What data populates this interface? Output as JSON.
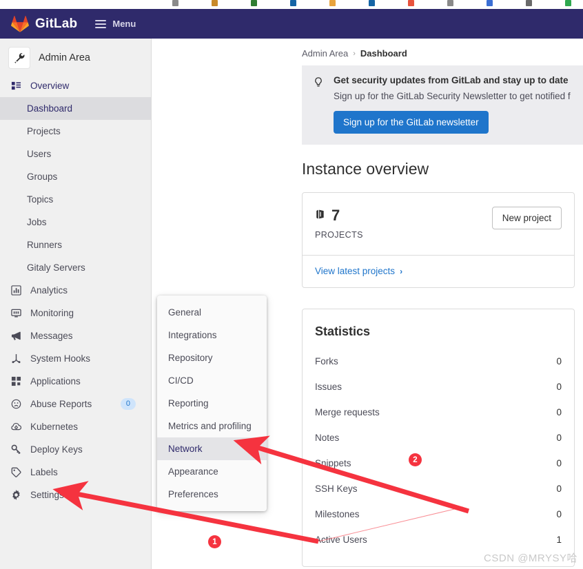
{
  "browser": {
    "bookmark_colors": [
      "#8a8a8a",
      "#c98a2a",
      "#2f7d32",
      "#1565a6",
      "#e8a33d",
      "#1565a6",
      "#e8533d",
      "#8a8a8a",
      "#3b6fd4",
      "#6a6a6a",
      "#2fa84f"
    ]
  },
  "navbar": {
    "brand": "GitLab",
    "menu_label": "Menu",
    "bg_color": "#2f2a6b"
  },
  "sidebar": {
    "context_name": "Admin Area",
    "context_icon": "wrench-icon",
    "items": [
      {
        "label": "Overview",
        "icon": "overview-icon",
        "type": "section",
        "active": false
      },
      {
        "label": "Dashboard",
        "icon": "",
        "type": "sub",
        "active": true
      },
      {
        "label": "Projects",
        "icon": "",
        "type": "sub",
        "active": false
      },
      {
        "label": "Users",
        "icon": "",
        "type": "sub",
        "active": false
      },
      {
        "label": "Groups",
        "icon": "",
        "type": "sub",
        "active": false
      },
      {
        "label": "Topics",
        "icon": "",
        "type": "sub",
        "active": false
      },
      {
        "label": "Jobs",
        "icon": "",
        "type": "sub",
        "active": false
      },
      {
        "label": "Runners",
        "icon": "",
        "type": "sub",
        "active": false
      },
      {
        "label": "Gitaly Servers",
        "icon": "",
        "type": "sub",
        "active": false
      },
      {
        "label": "Analytics",
        "icon": "chart-icon",
        "type": "item",
        "active": false
      },
      {
        "label": "Monitoring",
        "icon": "monitor-icon",
        "type": "item",
        "active": false
      },
      {
        "label": "Messages",
        "icon": "megaphone-icon",
        "type": "item",
        "active": false
      },
      {
        "label": "System Hooks",
        "icon": "hook-icon",
        "type": "item",
        "active": false
      },
      {
        "label": "Applications",
        "icon": "applications-icon",
        "type": "item",
        "active": false
      },
      {
        "label": "Abuse Reports",
        "icon": "abuse-icon",
        "type": "item",
        "active": false,
        "badge": "0"
      },
      {
        "label": "Kubernetes",
        "icon": "kubernetes-icon",
        "type": "item",
        "active": false
      },
      {
        "label": "Deploy Keys",
        "icon": "key-icon",
        "type": "item",
        "active": false
      },
      {
        "label": "Labels",
        "icon": "label-icon",
        "type": "item",
        "active": false
      },
      {
        "label": "Settings",
        "icon": "gear-icon",
        "type": "item",
        "active": false
      }
    ]
  },
  "flyout": {
    "items": [
      {
        "label": "General",
        "active": false
      },
      {
        "label": "Integrations",
        "active": false
      },
      {
        "label": "Repository",
        "active": false
      },
      {
        "label": "CI/CD",
        "active": false
      },
      {
        "label": "Reporting",
        "active": false
      },
      {
        "label": "Metrics and profiling",
        "active": false
      },
      {
        "label": "Network",
        "active": true
      },
      {
        "label": "Appearance",
        "active": false
      },
      {
        "label": "Preferences",
        "active": false
      }
    ]
  },
  "breadcrumb": {
    "root": "Admin Area",
    "separator": "›",
    "current": "Dashboard"
  },
  "banner": {
    "icon": "lightbulb-icon",
    "title": "Get security updates from GitLab and stay up to date",
    "description": "Sign up for the GitLab Security Newsletter to get notified f",
    "button_label": "Sign up for the GitLab newsletter",
    "button_color": "#1f75cb"
  },
  "main": {
    "page_title": "Instance overview",
    "projects_card": {
      "icon": "project-icon",
      "count": "7",
      "caption": "PROJECTS",
      "action_label": "New project",
      "link_label": "View latest projects",
      "link_chevron": "›"
    },
    "statistics": {
      "heading": "Statistics",
      "rows": [
        {
          "label": "Forks",
          "value": "0"
        },
        {
          "label": "Issues",
          "value": "0"
        },
        {
          "label": "Merge requests",
          "value": "0"
        },
        {
          "label": "Notes",
          "value": "0"
        },
        {
          "label": "Snippets",
          "value": "0"
        },
        {
          "label": "SSH Keys",
          "value": "0"
        },
        {
          "label": "Milestones",
          "value": "0"
        },
        {
          "label": "Active Users",
          "value": "1"
        }
      ]
    }
  },
  "annotations": {
    "color": "#f5333f",
    "marker_one": "1",
    "marker_two": "2"
  },
  "watermark": "CSDN @MRYSY哈"
}
